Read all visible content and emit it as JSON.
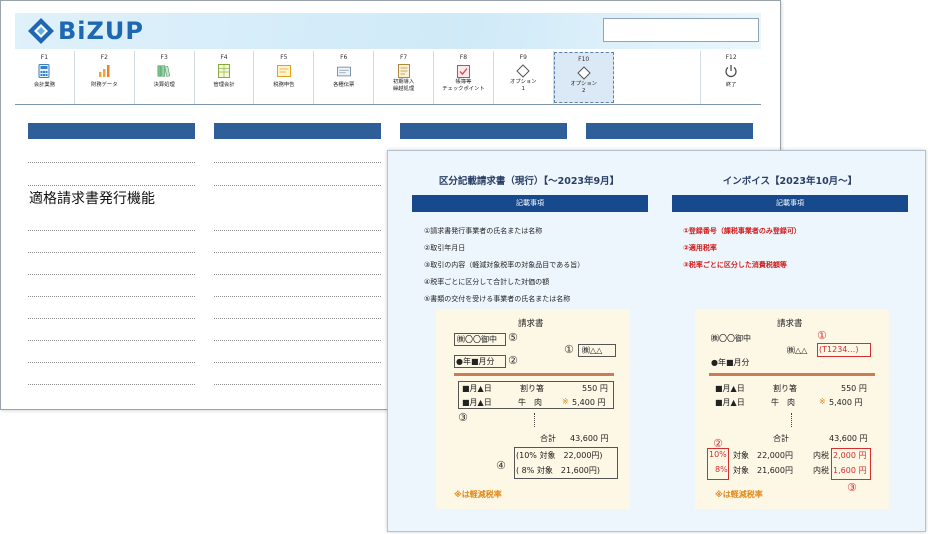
{
  "app": {
    "logo_text": "BiZUP",
    "feature_label": "適格請求書発行機能",
    "fkeys": [
      {
        "key": "F1",
        "label": "会計業務",
        "icon": "calculator-icon"
      },
      {
        "key": "F2",
        "label": "財務データ",
        "icon": "bar-chart-icon"
      },
      {
        "key": "F3",
        "label": "決算処理",
        "icon": "binders-icon"
      },
      {
        "key": "F4",
        "label": "管理会計",
        "icon": "spreadsheet-icon"
      },
      {
        "key": "F5",
        "label": "税務申告",
        "icon": "tax-form-icon"
      },
      {
        "key": "F6",
        "label": "各種伝票",
        "icon": "slip-icon"
      },
      {
        "key": "F7",
        "label": "初期導入",
        "label2": "繰越処理",
        "icon": "document-icon"
      },
      {
        "key": "F8",
        "label": "帳簿等",
        "label2": "チェックポイント",
        "icon": "checklist-icon"
      },
      {
        "key": "F9",
        "label": "オプション",
        "label2": "1",
        "icon": "diamond-icon"
      },
      {
        "key": "F10",
        "label": "オプション",
        "label2": "2",
        "icon": "diamond-icon"
      },
      {
        "key": "F12",
        "label": "終了",
        "icon": "power-icon"
      }
    ]
  },
  "panel": {
    "left": {
      "title": "区分記載請求書（現行）【〜2023年9月】",
      "bar": "記載事項",
      "items": [
        "①請求書発行事業者の氏名または名称",
        "②取引年月日",
        "③取引の内容（軽減対象税率の対象品目である旨）",
        "④税率ごとに区分して合計した対価の額",
        "⑤書類の交付を受ける事業者の氏名または名称"
      ],
      "doc": {
        "title": "請求書",
        "addressee": "㈱〇〇御中",
        "mark5": "⑤",
        "mark1": "①",
        "issuer": "㈱△△",
        "date": "●年■月分",
        "mark2": "②",
        "row1_date": "■月▲日",
        "row1_item": "割り箸",
        "row1_amount": "550 円",
        "row2_date": "■月▲日",
        "row2_item": "牛　肉",
        "row2_star": "※",
        "row2_amount": "5,400 円",
        "mark3": "③",
        "total_label": "合計",
        "total_amount": "43,600 円",
        "mark4": "④",
        "tax10": "(10% 対象　22,000円)",
        "tax8": "( 8% 対象　21,600円)",
        "note": "※は軽減税率"
      }
    },
    "right": {
      "title": "インボイス【2023年10月〜】",
      "bar": "記載事項",
      "items": [
        "①登録番号（課税事業者のみ登録可）",
        "②適用税率",
        "③税率ごとに区分した消費税額等"
      ],
      "doc": {
        "title": "請求書",
        "addressee": "㈱〇〇御中",
        "mark1": "①",
        "issuer": "㈱△△",
        "reg": "(T1234…)",
        "date": "●年■月分",
        "row1_date": "■月▲日",
        "row1_item": "割り箸",
        "row1_amount": "550 円",
        "row2_date": "■月▲日",
        "row2_item": "牛　肉",
        "row2_star": "※",
        "row2_amount": "5,400 円",
        "total_label": "合計",
        "total_amount": "43,600 円",
        "mark2": "②",
        "rate10": "10%",
        "obj10": "対象　22,000円",
        "taxlabel10": "内税",
        "tax10": "2,000 円",
        "rate8": "8%",
        "obj8": "対象　21,600円",
        "taxlabel8": "内税",
        "tax8": "1,600 円",
        "mark3": "③",
        "note": "※は軽減税率"
      }
    }
  }
}
